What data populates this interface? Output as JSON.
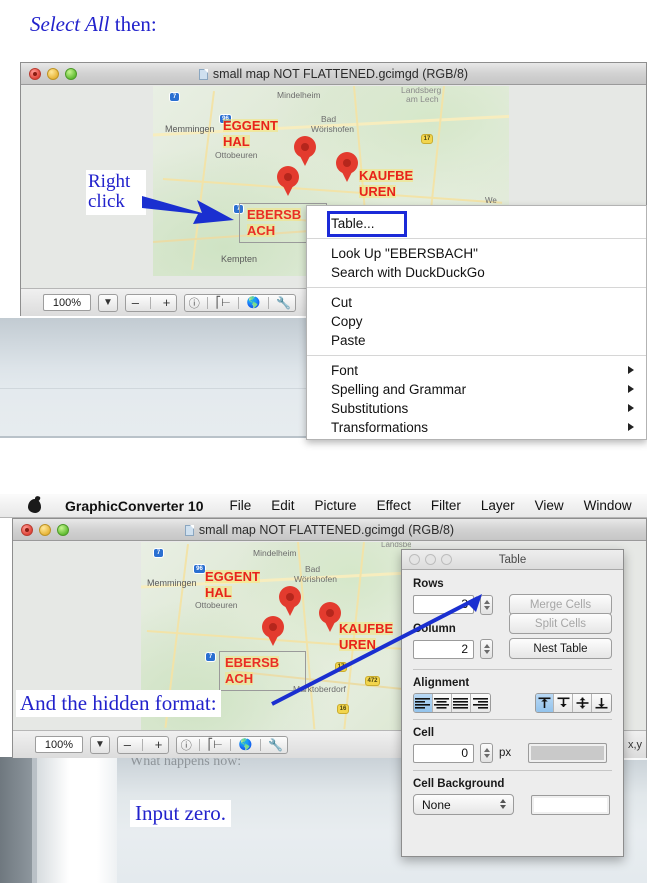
{
  "annotations": {
    "top_emphasis": "Select All",
    "top_rest": " then:",
    "right_click": "Right click",
    "hidden_format": "And the hidden format:",
    "input_zero": "Input zero.",
    "ghost_behind": "What happens now:",
    "accent_color": "#2222cc"
  },
  "window1": {
    "title": "small map NOT FLATTENED.gcimgd (RGB/8)",
    "lights": [
      "close",
      "minimize",
      "zoom"
    ],
    "toolbar": {
      "zoom_value": "100%",
      "caret": "▼",
      "minus": "–",
      "plus": "+",
      "info_icon": "info-icon",
      "ruler_icon": "ruler-icon",
      "globe_icon": "globe-icon",
      "wrench_icon": "wrench-icon"
    }
  },
  "window2": {
    "title": "small map NOT FLATTENED.gcimgd (RGB/8)",
    "toolbar": {
      "zoom_value": "100%",
      "caret": "▼",
      "minus": "–",
      "plus": "+",
      "coords_label": "x,y"
    }
  },
  "menubar": {
    "apple_icon": "apple-icon",
    "items": [
      {
        "label": "GraphicConverter 10",
        "bold": true
      },
      {
        "label": "File"
      },
      {
        "label": "Edit"
      },
      {
        "label": "Picture"
      },
      {
        "label": "Effect"
      },
      {
        "label": "Filter"
      },
      {
        "label": "Layer"
      },
      {
        "label": "View"
      },
      {
        "label": "Window"
      }
    ]
  },
  "context_menu": {
    "highlighted_item": "Table...",
    "groups": [
      {
        "items": [
          "Table..."
        ]
      },
      {
        "items": [
          "Look Up \"EBERSBACH\"",
          "Search with DuckDuckGo"
        ]
      },
      {
        "items": [
          "Cut",
          "Copy",
          "Paste"
        ]
      },
      {
        "items": [
          "Font",
          "Spelling and Grammar",
          "Substitutions",
          "Transformations"
        ],
        "submenu": true
      }
    ],
    "highlight_color": "#1b2ad8"
  },
  "table_dialog": {
    "title": "Table",
    "rows": {
      "label": "Rows",
      "value": "3"
    },
    "column": {
      "label": "Column",
      "value": "2"
    },
    "buttons": {
      "merge_cells": "Merge Cells",
      "split_cells": "Split Cells",
      "nest_table": "Nest Table"
    },
    "alignment": {
      "label": "Alignment",
      "horizontal": [
        "align-left-icon",
        "align-center-icon",
        "align-justify-icon",
        "align-right-icon"
      ],
      "horizontal_selected": 0,
      "vertical": [
        "align-top-icon",
        "align-middle-top-icon",
        "align-middle-icon",
        "align-bottom-icon"
      ],
      "vertical_selected": 0
    },
    "cell": {
      "label": "Cell",
      "value": "0",
      "unit": "px",
      "color": "#c9c9c9"
    },
    "cell_background": {
      "label": "Cell Background",
      "option": "None",
      "color": "#ffffff"
    }
  },
  "map": {
    "labels": [
      {
        "text": "Mindelheim",
        "size": 8
      },
      {
        "text": "Landsberg",
        "size": 8
      },
      {
        "text": "am Lech",
        "size": 8
      },
      {
        "text": "Memmingen",
        "size": 9
      },
      {
        "text": "Bad",
        "size": 8
      },
      {
        "text": "Wörishofen",
        "size": 8
      },
      {
        "text": "Ottobeuren",
        "size": 8
      },
      {
        "text": "Kempten",
        "size": 9
      },
      {
        "text": "Marktoberdorf",
        "size": 8
      }
    ],
    "red_labels": [
      "EGGENT",
      "HAL",
      "KAUFBE",
      "UREN",
      "EBERSB",
      "ACH"
    ],
    "shields": [
      "7",
      "96",
      "17",
      "7",
      "472",
      "16"
    ],
    "marker_count": 3,
    "marker_color": "#e33b2e"
  }
}
